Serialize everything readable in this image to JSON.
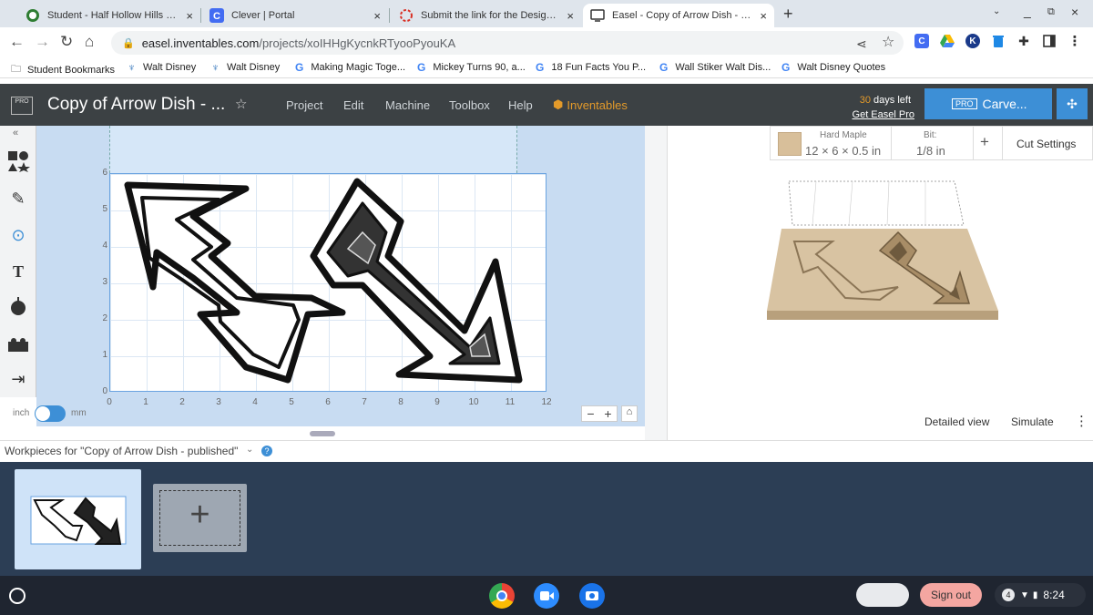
{
  "browser": {
    "tabs": [
      {
        "title": "Student - Half Hollow Hills Scho",
        "icon": "school-icon",
        "close": "×",
        "active": false
      },
      {
        "title": "Clever | Portal",
        "icon": "clever-icon",
        "close": "×",
        "active": false
      },
      {
        "title": "Submit the link for the Design Yo",
        "icon": "loading-icon",
        "close": "×",
        "active": false
      },
      {
        "title": "Easel - Copy of Arrow Dish - publ",
        "icon": "easel-icon",
        "close": "×",
        "active": true
      }
    ],
    "new_tab": "+",
    "url_host": "easel.inventables.com",
    "url_path": "/projects/xoIHHgKycnkRTyooPyouKA",
    "bookmarks": [
      {
        "label": "Student Bookmarks",
        "icon": "folder-icon"
      },
      {
        "label": "Walt Disney",
        "icon": "walt-disney-icon"
      },
      {
        "label": "Walt Disney",
        "icon": "walt-disney-icon"
      },
      {
        "label": "Making Magic Toge...",
        "icon": "google-icon"
      },
      {
        "label": "Mickey Turns 90, a...",
        "icon": "google-icon"
      },
      {
        "label": "18 Fun Facts You P...",
        "icon": "google-icon"
      },
      {
        "label": "Wall Stiker Walt Dis...",
        "icon": "google-icon"
      },
      {
        "label": "Walt Disney Quotes",
        "icon": "google-icon"
      }
    ]
  },
  "easel": {
    "pro_badge": "PRO",
    "project_title": "Copy of Arrow Dish - ...",
    "menu": [
      "Project",
      "Edit",
      "Machine",
      "Toolbox",
      "Help"
    ],
    "inventables": "Inventables",
    "trial_days": "30",
    "trial_text": "days left",
    "get_pro": "Get Easel Pro",
    "carve_badge": "PRO",
    "carve_label": "Carve..."
  },
  "canvas": {
    "y_ticks": [
      "6",
      "5",
      "4",
      "3",
      "2",
      "1",
      "0"
    ],
    "x_ticks": [
      "0",
      "1",
      "2",
      "3",
      "4",
      "5",
      "6",
      "7",
      "8",
      "9",
      "10",
      "11",
      "12"
    ],
    "unit_inch": "inch",
    "unit_mm": "mm",
    "zoom_out": "−",
    "zoom_in": "+"
  },
  "material": {
    "name": "Hard Maple",
    "size": "12 × 6 × 0.5 in",
    "bit_label": "Bit:",
    "bit_value": "1/8 in",
    "add": "+",
    "cut_settings": "Cut Settings"
  },
  "preview": {
    "detailed_view": "Detailed view",
    "simulate": "Simulate"
  },
  "workpieces": {
    "title": "Workpieces for \"Copy of Arrow Dish - published\"",
    "add": "+"
  },
  "shelf": {
    "sign_out": "Sign out",
    "notifications": "4",
    "time": "8:24"
  },
  "colors": {
    "easel_header": "#3c4144",
    "carve_button": "#3d8fd6",
    "canvas_bg": "#c8dcf2",
    "workpiece_bg": "#2c3e55",
    "inventables": "#e39a2a",
    "sign_out": "#f4a6a1"
  }
}
